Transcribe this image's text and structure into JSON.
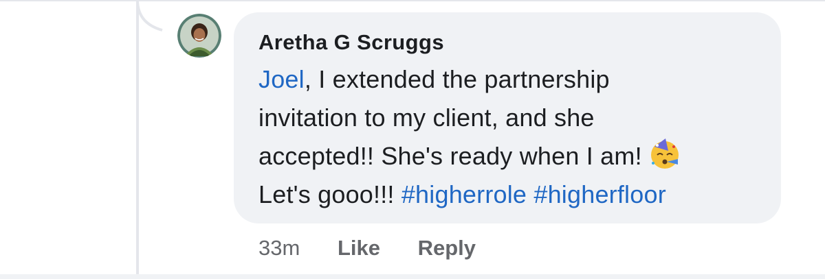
{
  "comment": {
    "author": "Aretha G Scruggs",
    "mention": "Joel",
    "text_line1_rest": ", I extended the partnership",
    "text_line2": "invitation to my client, and she",
    "text_line3": "accepted!! She's ready when I am!",
    "text_line4_start": "Let's gooo!!!",
    "hashtags": [
      "#higherrole",
      "#higherfloor"
    ],
    "emoji_icon": "partying-face-icon"
  },
  "actions": {
    "timestamp": "33m",
    "like_label": "Like",
    "reply_label": "Reply"
  },
  "colors": {
    "bubble_bg": "#f0f2f5",
    "link": "#1f67c4",
    "text": "#1c1e21",
    "meta": "#65676b"
  }
}
